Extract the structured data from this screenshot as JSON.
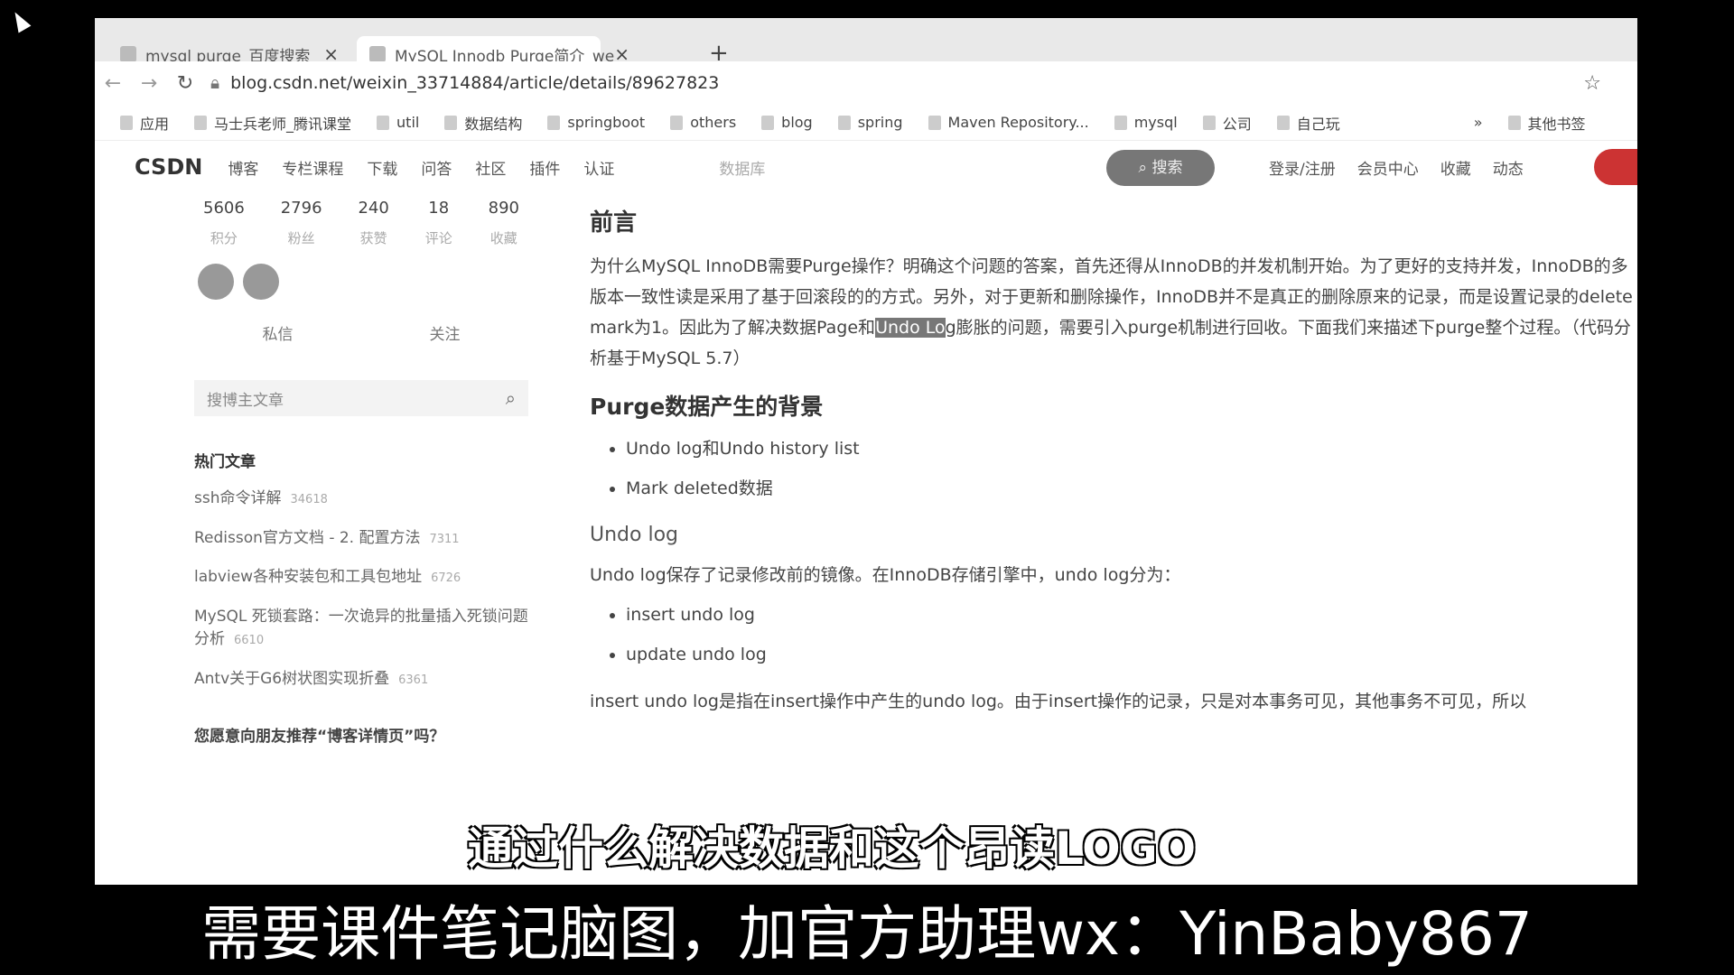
{
  "browser": {
    "tabs": [
      {
        "title": "mysql purge_百度搜索"
      },
      {
        "title": "MySQL Innodb Purge简介_we"
      }
    ],
    "new_tab": "+",
    "url": "blog.csdn.net/weixin_33714884/article/details/89627823",
    "bookmarks": [
      "应用",
      "马士兵老师_腾讯课堂",
      "util",
      "数据结构",
      "springboot",
      "others",
      "blog",
      "spring",
      "Maven Repository...",
      "mysql",
      "公司",
      "自己玩",
      "»",
      "其他书签"
    ]
  },
  "site_nav": {
    "logo": "CSDN",
    "items": [
      "博客",
      "专栏课程",
      "下载",
      "问答",
      "社区",
      "插件",
      "认证"
    ],
    "search_placeholder": "数据库",
    "search_button": "搜索",
    "right_items": [
      "登录/注册",
      "会员中心",
      "收藏",
      "动态"
    ]
  },
  "sidebar": {
    "stats": [
      {
        "value": "5606",
        "label": "积分"
      },
      {
        "value": "2796",
        "label": "粉丝"
      },
      {
        "value": "240",
        "label": "获赞"
      },
      {
        "value": "18",
        "label": "评论"
      },
      {
        "value": "890",
        "label": "收藏"
      }
    ],
    "actions": [
      "私信",
      "关注"
    ],
    "search_placeholder": "搜博主文章",
    "hot_title": "热门文章",
    "articles": [
      {
        "title": "ssh命令详解",
        "views": "34618"
      },
      {
        "title": "Redisson官方文档 - 2. 配置方法",
        "views": "7311"
      },
      {
        "title": "labview各种安装包和工具包地址",
        "views": "6726"
      },
      {
        "title": "MySQL 死锁套路：一次诡异的批量插入死锁问题分析",
        "views": "6610"
      },
      {
        "title": "Antv关于G6树状图实现折叠",
        "views": "6361"
      }
    ],
    "recommend": "您愿意向朋友推荐“博客详情页”吗？"
  },
  "article": {
    "h_intro": "前言",
    "intro_a": "为什么MySQL InnoDB需要Purge操作？明确这个问题的答案，首先还得从InnoDB的并发机制开始。为了更好的支持并发，InnoDB的多版本一致性读是采用了基于回滚段的的方式。另外，对于更新和删除操作，InnoDB并不是真正的删除原来的记录，而是设置记录的delete mark为1。因此为了解决数据Page和",
    "intro_hl": "Undo Lo",
    "intro_b": "g膨胀的问题，需要引入purge机制进行回收。下面我们来描述下purge整个过程。（代码分析基于MySQL 5.7）",
    "h_bg": "Purge数据产生的背景",
    "bg_items": [
      "Undo log和Undo history list",
      "Mark deleted数据"
    ],
    "h_undo": "Undo log",
    "undo_p": "Undo log保存了记录修改前的镜像。在InnoDB存储引擎中，undo log分为：",
    "undo_items": [
      "insert undo log",
      "update undo log"
    ],
    "insert_p": "insert undo log是指在insert操作中产生的undo log。由于insert操作的记录，只是对本事务可见，其他事务不可见，所以"
  },
  "overlay": {
    "subtitle": "通过什么解决数据和这个昂读LOGO",
    "banner": "需要课件笔记脑图，加官方助理wx：YinBaby867"
  }
}
